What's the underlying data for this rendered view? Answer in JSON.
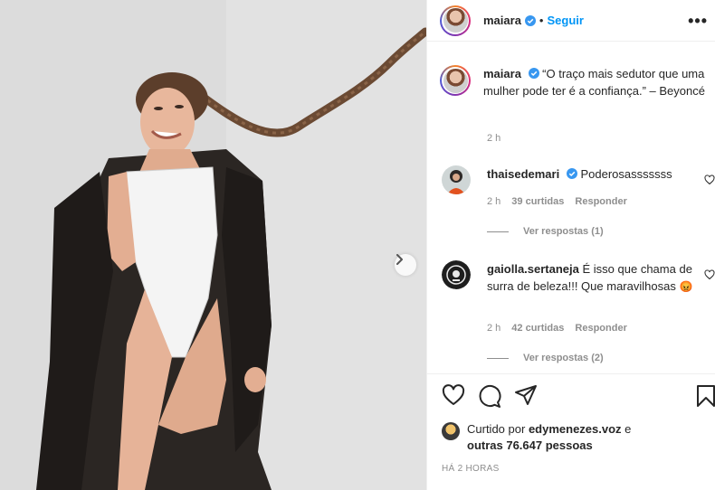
{
  "post": {
    "username": "maiara",
    "follow_label": "Seguir",
    "more_label": "•••",
    "separator": "•"
  },
  "caption": {
    "username": "maiara",
    "text": "“O traço mais sedutor que uma mulher pode ter é a confiança.” – Beyoncé",
    "time": "2 h"
  },
  "comments": [
    {
      "username": "thaisedemari",
      "text": "Poderosasssssss",
      "time": "2 h",
      "likes": "39 curtidas",
      "reply_label": "Responder",
      "view_replies": "Ver respostas (1)"
    },
    {
      "username": "gaiolla.sertaneja",
      "text": "É isso que chama de surra de beleza!!! Que maravilhosas",
      "emoji": "😡",
      "time": "2 h",
      "likes": "42 curtidas",
      "reply_label": "Responder",
      "view_replies": "Ver respostas (2)"
    }
  ],
  "likes": {
    "prefix": "Curtido por",
    "user": "edymenezes.voz",
    "connector": "e",
    "others": "outras 76.647 pessoas"
  },
  "posted_time": "HÁ 2 HORAS",
  "icons": {
    "verified": "verified-badge-icon",
    "like": "heart-icon",
    "comment": "comment-icon",
    "share": "paper-plane-icon",
    "save": "bookmark-icon",
    "next": "chevron-right-icon"
  },
  "colors": {
    "link": "#0095f6",
    "verified": "#3897f0",
    "muted": "#8e8e8e",
    "text": "#262626"
  }
}
